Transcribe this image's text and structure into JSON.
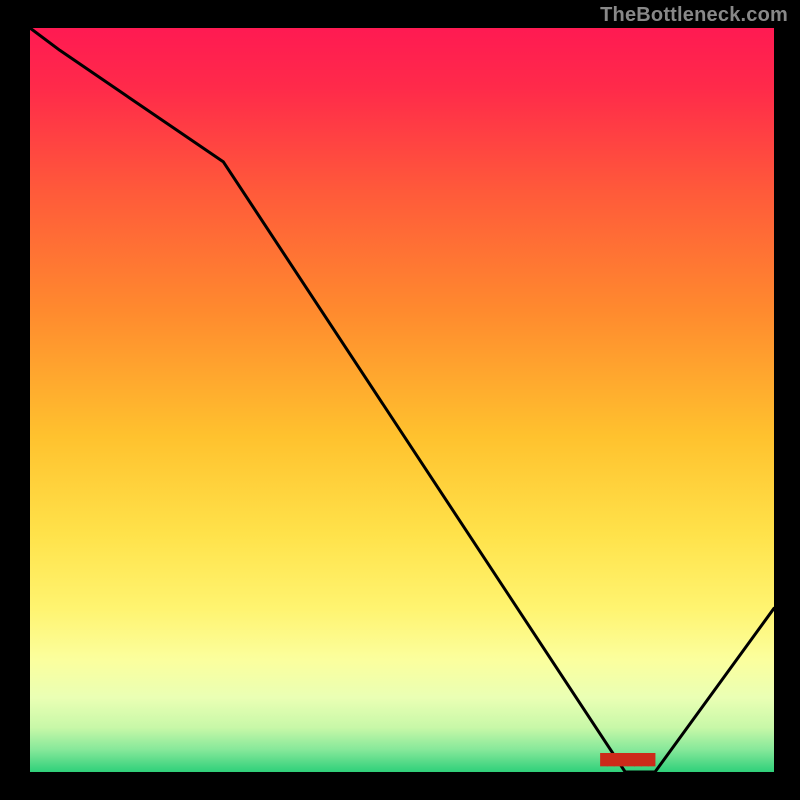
{
  "watermark": "TheBottleneck.com",
  "marker_label": "████████",
  "chart_data": {
    "type": "line",
    "title": "",
    "xlabel": "",
    "ylabel": "",
    "ylim": [
      0,
      100
    ],
    "xlim": [
      0,
      100
    ],
    "x": [
      0,
      4,
      26,
      80,
      84,
      100
    ],
    "values": [
      100,
      97,
      82,
      0,
      0,
      22
    ],
    "minimum_x_range": [
      80,
      84
    ],
    "background": "vertical-gradient",
    "gradient_colors": [
      "#ff1a4a",
      "#ff8a2a",
      "#ffd02a",
      "#fff56a",
      "#e8ff9a",
      "#2ecc71"
    ]
  }
}
